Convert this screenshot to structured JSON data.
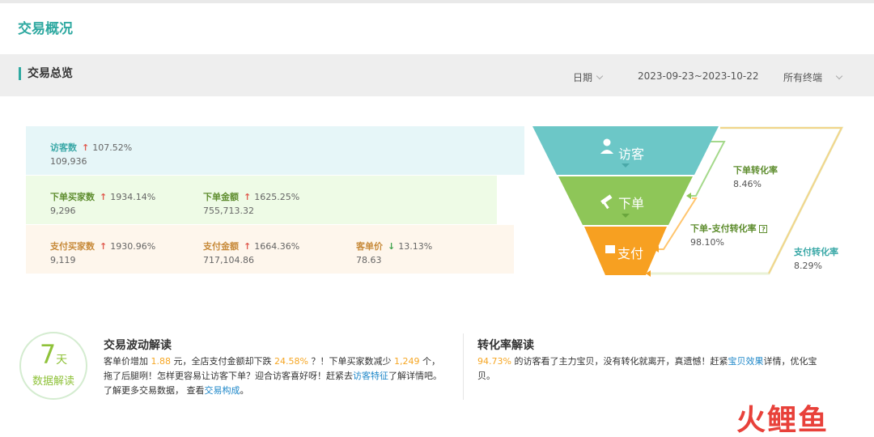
{
  "page": {
    "title": "交易概况"
  },
  "overview": {
    "title": "交易总览",
    "date_label": "日期",
    "date_range": "2023-09-23~2023-10-22",
    "terminal_label": "所有终端"
  },
  "metrics": {
    "visitors": {
      "label": "访客数",
      "change": "107.52%",
      "value": "109,936"
    },
    "order_buyers": {
      "label": "下单买家数",
      "change": "1934.14%",
      "value": "9,296"
    },
    "order_amount": {
      "label": "下单金额",
      "change": "1625.25%",
      "value": "755,713.32"
    },
    "pay_buyers": {
      "label": "支付买家数",
      "change": "1930.96%",
      "value": "9,119"
    },
    "pay_amount": {
      "label": "支付金额",
      "change": "1664.36%",
      "value": "717,104.86"
    },
    "unit_price": {
      "label": "客单价",
      "change": "13.13%",
      "value": "78.63"
    }
  },
  "funnel": {
    "visit": "访客",
    "order": "下单",
    "pay": "支付",
    "order_conv": {
      "label": "下单转化率",
      "value": "8.46%"
    },
    "order_pay_conv": {
      "label": "下单-支付转化率",
      "value": "98.10%"
    },
    "pay_conv": {
      "label": "支付转化率",
      "value": "8.29%"
    }
  },
  "badge": {
    "days": "7",
    "unit": "天",
    "text": "数据解读"
  },
  "trade": {
    "title": "交易波动解读",
    "t1": "客单价增加",
    "v1": "1.88",
    "t2": "元，全店支付金额却下跌",
    "v2": "24.58%",
    "t3": "？！下单买家数减少",
    "v3": "1,249",
    "t4": "个，拖了后腿咧！怎样更容易让访客下单？迎合访客喜好呀！赶紧去",
    "link1": "访客特征",
    "t5": "了解详情吧。",
    "t6": "了解更多交易数据，  查看",
    "link2": "交易构成",
    "t7": "。"
  },
  "conversion": {
    "title": "转化率解读",
    "v1": "94.73%",
    "t1": "的访客看了主力宝贝，没有转化就离开，真遗憾！赶紧",
    "link1": "宝贝效果",
    "t2": "详情，优化宝贝。"
  },
  "watermark": "火鲤鱼",
  "colors": {
    "teal": "#6cc7c7",
    "green": "#8ec658",
    "orange": "#f7a021",
    "accent": "#2fa9a1"
  }
}
